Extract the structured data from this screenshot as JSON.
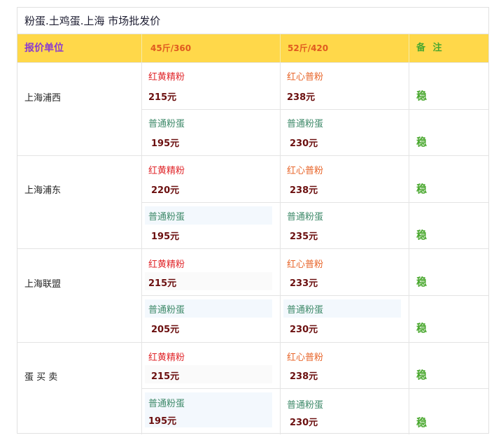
{
  "title": "粉蛋.土鸡蛋.上海 市场批发价",
  "headers": [
    "报价单位",
    "45斤/360",
    "52斤/420",
    "备 注"
  ],
  "groups": [
    {
      "location": "上海浦西",
      "rows": [
        {
          "left_name": "红黄精粉",
          "left_price": "215元",
          "right_name": "红心普粉",
          "right_price": "238元",
          "note": "稳"
        },
        {
          "left_name": "普通粉蛋",
          "left_price": "195元",
          "right_name": "普通粉蛋",
          "right_price": "230元",
          "note": "稳"
        }
      ]
    },
    {
      "location": "上海浦东",
      "rows": [
        {
          "left_name": "红黄精粉",
          "left_price": "220元",
          "right_name": "红心普粉",
          "right_price": "238元",
          "note": "稳"
        },
        {
          "left_name": "普通粉蛋",
          "left_price": "195元",
          "right_name": "普通粉蛋",
          "right_price": "235元",
          "note": "稳"
        }
      ]
    },
    {
      "location": "上海联盟",
      "rows": [
        {
          "left_name": "红黄精粉",
          "left_price": "215元",
          "right_name": "红心普粉",
          "right_price": "233元",
          "note": "稳"
        },
        {
          "left_name": "普通粉蛋",
          "left_price": "205元",
          "right_name": "普通粉蛋",
          "right_price": "230元",
          "note": "稳"
        }
      ]
    },
    {
      "location": "蛋 买 卖",
      "rows": [
        {
          "left_name": "红黄精粉",
          "left_price": "215元",
          "right_name": "红心普粉",
          "right_price": "238元",
          "note": "稳"
        },
        {
          "left_name": "普通粉蛋",
          "left_price": "195元",
          "right_name": "普通粉蛋",
          "right_price": "230元",
          "note": "稳"
        }
      ]
    }
  ]
}
